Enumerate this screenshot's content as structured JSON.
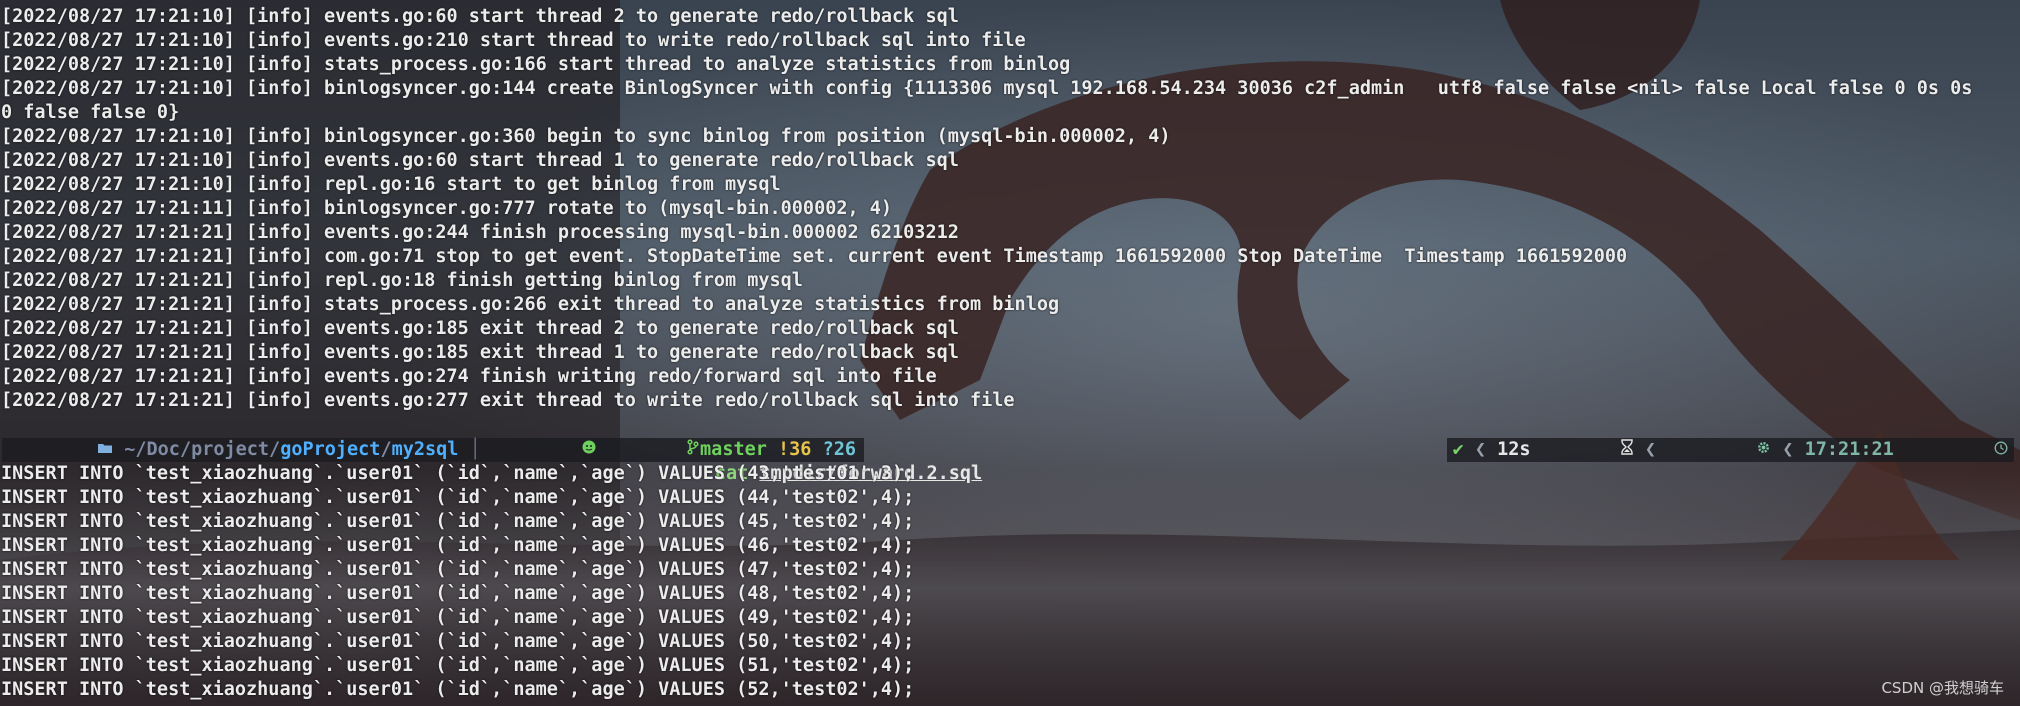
{
  "log_lines": [
    "[2022/08/27 17:21:10] [info] events.go:60 start thread 2 to generate redo/rollback sql",
    "[2022/08/27 17:21:10] [info] events.go:210 start thread to write redo/rollback sql into file",
    "[2022/08/27 17:21:10] [info] stats_process.go:166 start thread to analyze statistics from binlog",
    "[2022/08/27 17:21:10] [info] binlogsyncer.go:144 create BinlogSyncer with config {1113306 mysql 192.168.54.234 30036 c2f_admin   utf8 false false <nil> false Local false 0 0s 0s",
    "0 false false 0}",
    "[2022/08/27 17:21:10] [info] binlogsyncer.go:360 begin to sync binlog from position (mysql-bin.000002, 4)",
    "[2022/08/27 17:21:10] [info] events.go:60 start thread 1 to generate redo/rollback sql",
    "[2022/08/27 17:21:10] [info] repl.go:16 start to get binlog from mysql",
    "[2022/08/27 17:21:11] [info] binlogsyncer.go:777 rotate to (mysql-bin.000002, 4)",
    "[2022/08/27 17:21:21] [info] events.go:244 finish processing mysql-bin.000002 62103212",
    "[2022/08/27 17:21:21] [info] com.go:71 stop to get event. StopDateTime set. current event Timestamp 1661592000 Stop DateTime  Timestamp 1661592000",
    "[2022/08/27 17:21:21] [info] repl.go:18 finish getting binlog from mysql",
    "[2022/08/27 17:21:21] [info] stats_process.go:266 exit thread to analyze statistics from binlog",
    "[2022/08/27 17:21:21] [info] events.go:185 exit thread 2 to generate redo/rollback sql",
    "[2022/08/27 17:21:21] [info] events.go:185 exit thread 1 to generate redo/rollback sql",
    "[2022/08/27 17:21:21] [info] events.go:274 finish writing redo/forward sql into file",
    "[2022/08/27 17:21:21] [info] events.go:277 exit thread to write redo/rollback sql into file"
  ],
  "prompt": {
    "path_prefix": "~/Doc/project/",
    "path_mid": "goProject",
    "path_sep": "/",
    "path_last": "my2sql",
    "branch": "master",
    "modified": "!36",
    "untracked": "?26",
    "command": "cat",
    "argument": "tmpdir/forward.2.sql",
    "status_ok": "✔",
    "duration": "12s",
    "time": "17:21:21",
    "icons": [
      "folder-icon",
      "github-icon",
      "git-branch-icon",
      "check-icon",
      "hourglass-icon",
      "gear-icon",
      "clock-icon"
    ]
  },
  "output_lines": [
    "INSERT INTO `test_xiaozhuang`.`user01` (`id`,`name`,`age`) VALUES (43,'test01',3);",
    "INSERT INTO `test_xiaozhuang`.`user01` (`id`,`name`,`age`) VALUES (44,'test02',4);",
    "INSERT INTO `test_xiaozhuang`.`user01` (`id`,`name`,`age`) VALUES (45,'test02',4);",
    "INSERT INTO `test_xiaozhuang`.`user01` (`id`,`name`,`age`) VALUES (46,'test02',4);",
    "INSERT INTO `test_xiaozhuang`.`user01` (`id`,`name`,`age`) VALUES (47,'test02',4);",
    "INSERT INTO `test_xiaozhuang`.`user01` (`id`,`name`,`age`) VALUES (48,'test02',4);",
    "INSERT INTO `test_xiaozhuang`.`user01` (`id`,`name`,`age`) VALUES (49,'test02',4);",
    "INSERT INTO `test_xiaozhuang`.`user01` (`id`,`name`,`age`) VALUES (50,'test02',4);",
    "INSERT INTO `test_xiaozhuang`.`user01` (`id`,`name`,`age`) VALUES (51,'test02',4);",
    "INSERT INTO `test_xiaozhuang`.`user01` (`id`,`name`,`age`) VALUES (52,'test02',4);"
  ],
  "watermark": "CSDN @我想骑车",
  "colors": {
    "text": "#ececec",
    "path": "#5aa7f0",
    "git_branch": "#6fd15d",
    "git_modified": "#e8c34a",
    "git_untracked": "#6fc4d6",
    "command": "#8bd67a"
  }
}
